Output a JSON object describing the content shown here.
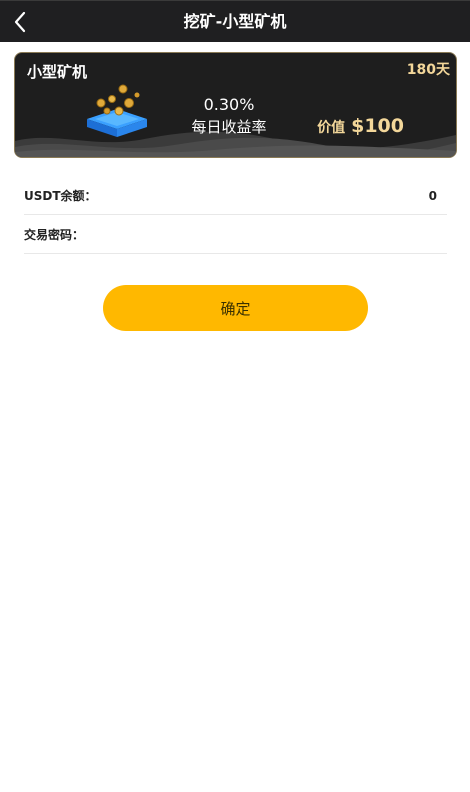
{
  "header": {
    "title": "挖矿-小型矿机",
    "back_icon": "chevron-left-icon"
  },
  "miner_card": {
    "name": "小型矿机",
    "duration": "180天",
    "daily_rate": "0.30%",
    "daily_rate_label": "每日收益率",
    "price_label": "价值",
    "price": "$100",
    "illustration_icon": "coin-mining-icon",
    "accent_color": "#f3d79a"
  },
  "form": {
    "balance_label": "USDT余额：",
    "balance_value": "0",
    "password_label": "交易密码："
  },
  "confirm_button": {
    "label": "确定",
    "color": "#ffb800"
  }
}
